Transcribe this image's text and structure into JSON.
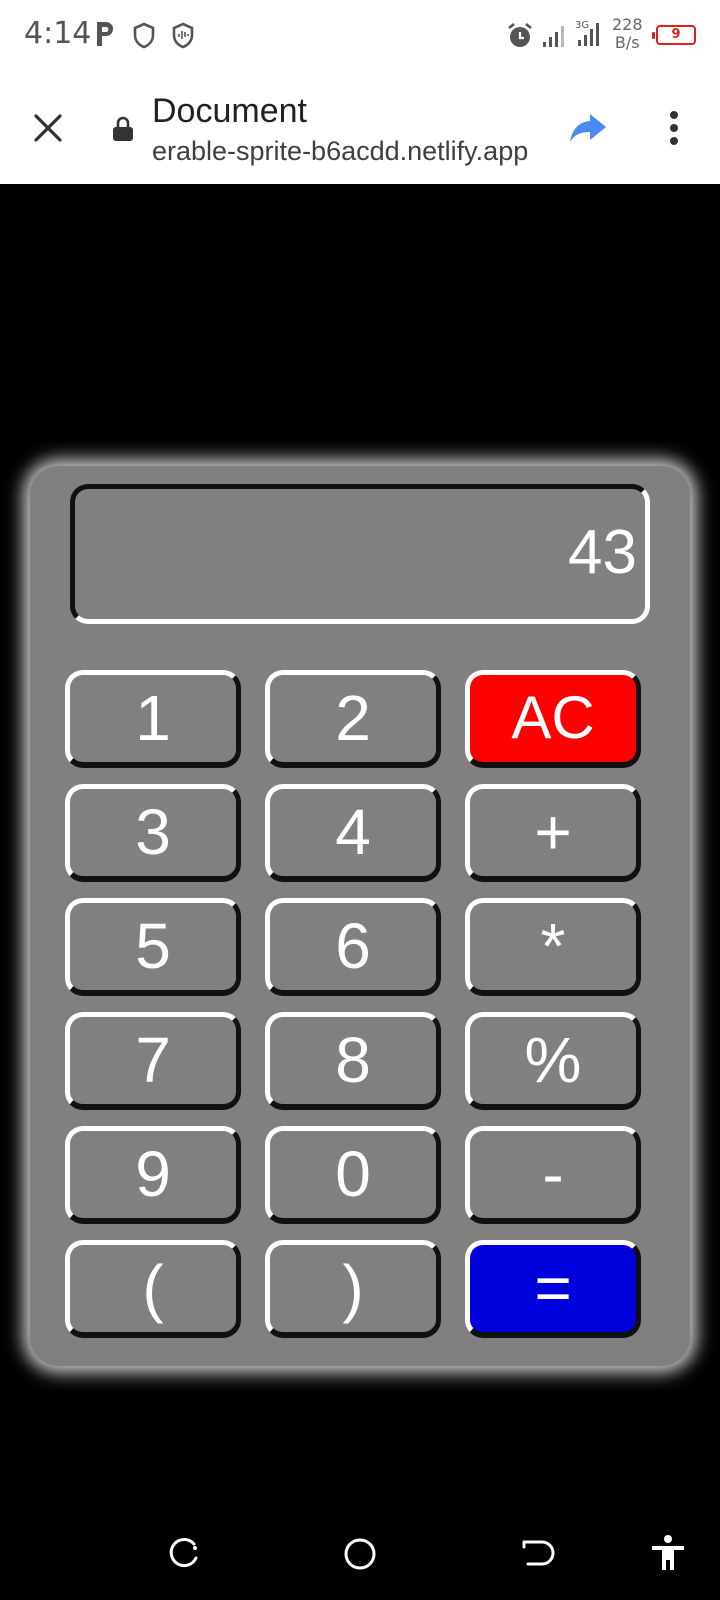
{
  "status_bar": {
    "time": "4:14",
    "net_speed_value": "228",
    "net_speed_unit": "B/s",
    "battery_level": "9",
    "battery_color": "#e02020"
  },
  "browser": {
    "title": "Document",
    "url": "erable-sprite-b6acdd.netlify.app",
    "accent_color": "#4a8af4"
  },
  "calculator": {
    "display_value": "43",
    "keys": [
      {
        "label": "1"
      },
      {
        "label": "2"
      },
      {
        "label": "AC"
      },
      {
        "label": "3"
      },
      {
        "label": "4"
      },
      {
        "label": "+"
      },
      {
        "label": "5"
      },
      {
        "label": "6"
      },
      {
        "label": "*"
      },
      {
        "label": "7"
      },
      {
        "label": "8"
      },
      {
        "label": "%"
      },
      {
        "label": "9"
      },
      {
        "label": "0"
      },
      {
        "label": "-"
      },
      {
        "label": "("
      },
      {
        "label": ")"
      },
      {
        "label": "="
      }
    ],
    "colors": {
      "body": "#808080",
      "clear_key": "#ff0000",
      "equals_key": "#0000dd"
    }
  },
  "icons": {
    "status": [
      "parking-icon",
      "shield-icon",
      "shield-wave-icon",
      "alarm-icon",
      "signal-icon",
      "signal-3g-icon",
      "battery-icon"
    ],
    "browser": [
      "close-icon",
      "lock-icon",
      "share-icon",
      "more-vert-icon"
    ],
    "nav": [
      "recent-apps-icon",
      "home-icon",
      "back-icon",
      "accessibility-icon"
    ]
  }
}
